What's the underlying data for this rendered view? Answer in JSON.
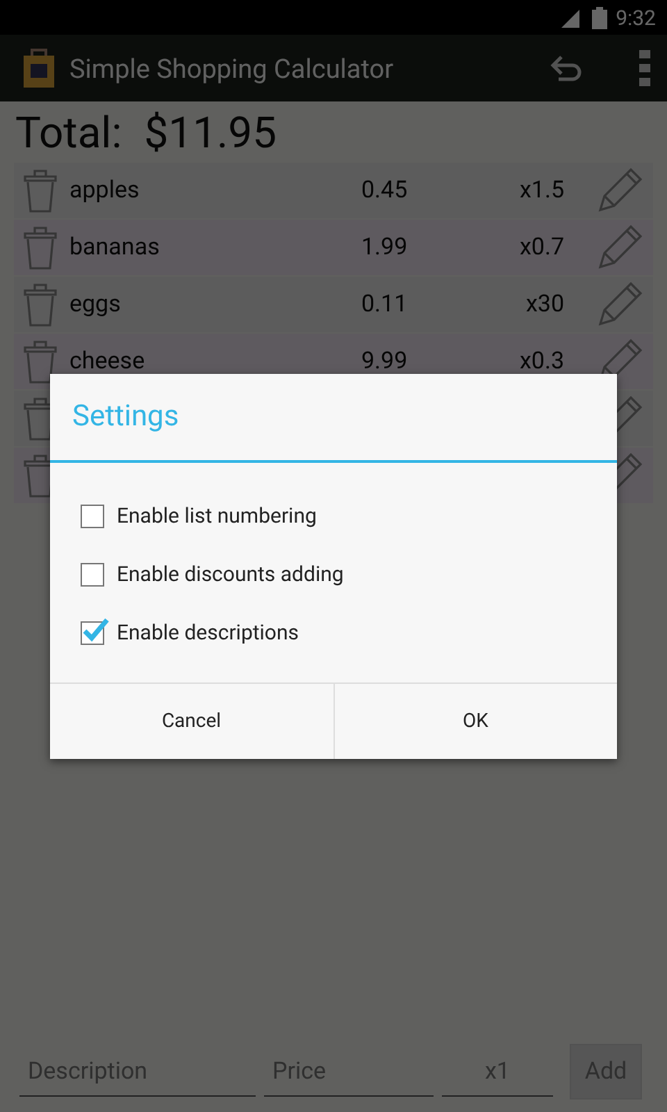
{
  "status_bar": {
    "time": "9:32"
  },
  "action_bar": {
    "title": "Simple Shopping Calculator"
  },
  "total": {
    "label": "Total:",
    "value": "$11.95"
  },
  "items": [
    {
      "kind": "item",
      "name": "apples",
      "price": "0.45",
      "quantity": "x1.5"
    },
    {
      "kind": "item",
      "name": "bananas",
      "price": "1.99",
      "quantity": "x0.7"
    },
    {
      "kind": "item",
      "name": "eggs",
      "price": "0.11",
      "quantity": "x30"
    },
    {
      "kind": "item",
      "name": "cheese",
      "price": "9.99",
      "quantity": "x0.3"
    },
    {
      "kind": "covered"
    },
    {
      "kind": "covered"
    }
  ],
  "add_bar": {
    "description_placeholder": "Description",
    "price_placeholder": "Price",
    "quantity_placeholder": "x1",
    "add_button": "Add"
  },
  "dialog": {
    "title": "Settings",
    "options": [
      {
        "label": "Enable list numbering",
        "checked": false
      },
      {
        "label": "Enable discounts adding",
        "checked": false
      },
      {
        "label": "Enable descriptions",
        "checked": true
      }
    ],
    "buttons": [
      "Cancel",
      "OK"
    ]
  }
}
